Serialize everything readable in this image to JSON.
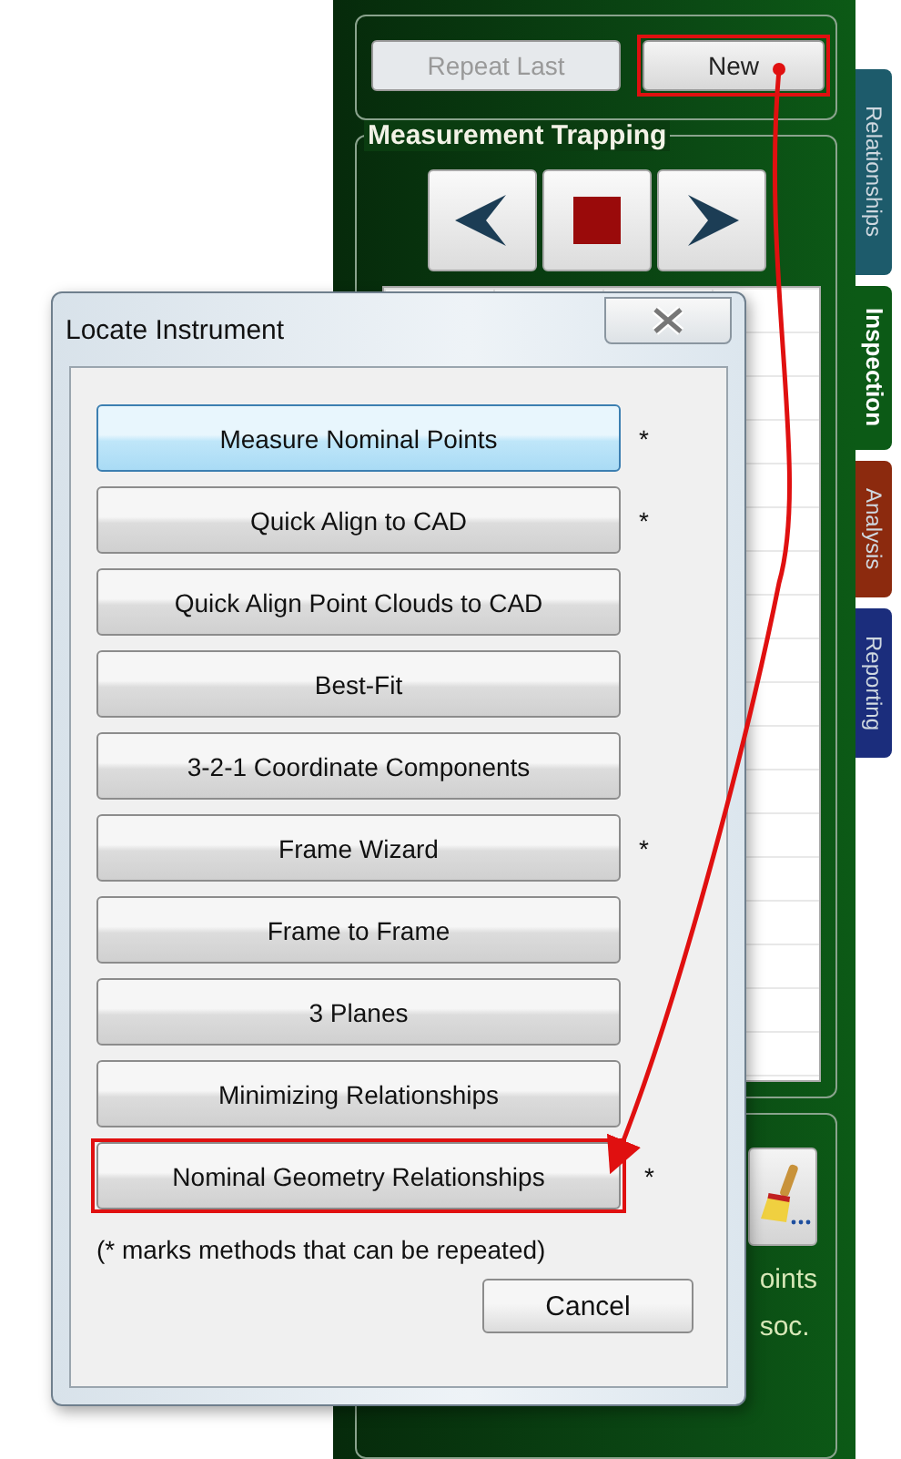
{
  "panel": {
    "top_buttons": [
      {
        "label": "Repeat Last",
        "disabled": true,
        "highlighted": false
      },
      {
        "label": "New",
        "disabled": false,
        "highlighted": true
      }
    ],
    "trapping": {
      "title": "Measurement Trapping"
    },
    "side_tabs": [
      {
        "label": "Relationships",
        "color": "#1d5b6b",
        "selected": false
      },
      {
        "label": "Inspection",
        "color": "#0c5a16",
        "selected": true
      },
      {
        "label": "Analysis",
        "color": "#8c2a0e",
        "selected": false
      },
      {
        "label": "Reporting",
        "color": "#1b2d7c",
        "selected": false
      }
    ],
    "cut_texts": [
      "oints",
      "soc."
    ]
  },
  "dialog": {
    "title": "Locate Instrument",
    "methods": [
      {
        "label": "Measure Nominal Points",
        "mark": "*",
        "selected": true,
        "highlighted": false
      },
      {
        "label": "Quick Align to CAD",
        "mark": "*",
        "selected": false,
        "highlighted": false
      },
      {
        "label": "Quick Align Point Clouds to CAD",
        "selected": false,
        "highlighted": false
      },
      {
        "label": "Best-Fit",
        "selected": false,
        "highlighted": false
      },
      {
        "label": "3-2-1 Coordinate Components",
        "selected": false,
        "highlighted": false
      },
      {
        "label": "Frame Wizard",
        "mark": "*",
        "selected": false,
        "highlighted": false
      },
      {
        "label": "Frame to Frame",
        "selected": false,
        "highlighted": false
      },
      {
        "label": "3 Planes",
        "selected": false,
        "highlighted": false
      },
      {
        "label": "Minimizing Relationships",
        "selected": false,
        "highlighted": false
      },
      {
        "label": "Nominal Geometry Relationships",
        "mark": "*",
        "selected": false,
        "highlighted": true
      }
    ],
    "note": "(* marks methods that can be repeated)",
    "cancel": "Cancel"
  }
}
